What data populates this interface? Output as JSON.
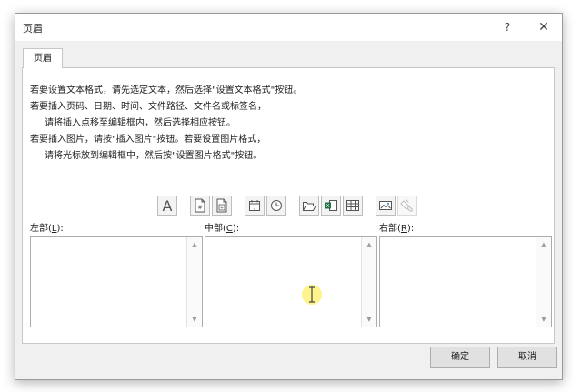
{
  "dialog": {
    "title": "页眉",
    "help_label": "?",
    "close_label": "✕"
  },
  "tab": {
    "label": "页眉"
  },
  "instructions": [
    "若要设置文本格式，请先选定文本，然后选择\"设置文本格式\"按钮。",
    "若要插入页码、日期、时间、文件路径、文件名或标签名，",
    "请将插入点移至编辑框内，然后选择相应按钮。",
    "若要插入图片，请按\"插入图片\"按钮。若要设置图片格式，",
    "请将光标放到编辑框中，然后按\"设置图片格式\"按钮。"
  ],
  "toolbar": {
    "format_text_glyph": "A",
    "buttons": [
      {
        "name": "format-text-icon",
        "enabled": true
      },
      {
        "name": "page-number-icon",
        "enabled": true
      },
      {
        "name": "number-of-pages-icon",
        "enabled": true
      },
      {
        "name": "date-icon",
        "enabled": true
      },
      {
        "name": "time-icon",
        "enabled": true
      },
      {
        "name": "file-path-icon",
        "enabled": true
      },
      {
        "name": "file-name-icon",
        "enabled": true
      },
      {
        "name": "sheet-name-icon",
        "enabled": true
      },
      {
        "name": "insert-picture-icon",
        "enabled": true
      },
      {
        "name": "format-picture-icon",
        "enabled": false
      }
    ]
  },
  "sections": {
    "left": {
      "label_prefix": "左部(",
      "accesskey": "L",
      "label_suffix": "):"
    },
    "center": {
      "label_prefix": "中部(",
      "accesskey": "C",
      "label_suffix": "):"
    },
    "right": {
      "label_prefix": "右部(",
      "accesskey": "R",
      "label_suffix": "):"
    }
  },
  "buttons": {
    "ok": "确定",
    "cancel": "取消"
  },
  "colors": {
    "dialog_bg": "#f0f0f0",
    "cursor_highlight": "#ffec50"
  }
}
